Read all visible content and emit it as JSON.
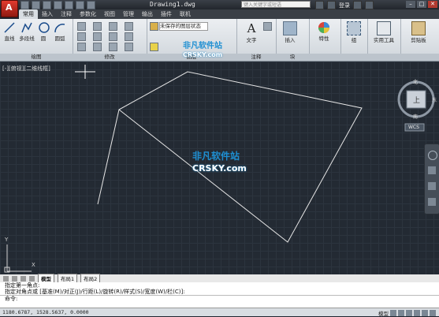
{
  "titlebar": {
    "document_title": "Drawing1.dwg",
    "search_placeholder": "键入关键字或短语",
    "user": "登录",
    "win_minimize": "–",
    "win_restore": "□",
    "win_close": "✕"
  },
  "tabs": [
    "常用",
    "插入",
    "注释",
    "参数化",
    "视图",
    "管理",
    "输出",
    "插件",
    "联机"
  ],
  "ribbon": {
    "panels": [
      {
        "label": "绘图",
        "tools": [
          "直线",
          "多段线",
          "圆",
          "圆弧"
        ]
      },
      {
        "label": "修改",
        "tools": []
      },
      {
        "label": "图层",
        "tools": [
          "未保存的图层状态"
        ]
      },
      {
        "label": "注释",
        "tools": [
          "文字"
        ]
      },
      {
        "label": "块",
        "tools": [
          "插入"
        ]
      },
      {
        "label": "",
        "tools": [
          "特性"
        ]
      },
      {
        "label": "",
        "tools": [
          "组"
        ]
      },
      {
        "label": "",
        "tools": [
          "实用工具"
        ]
      },
      {
        "label": "",
        "tools": [
          "剪贴板"
        ]
      }
    ]
  },
  "viewport": {
    "label": "[-][俯视][二维线框]",
    "viewcube_top": "北",
    "viewcube_face": "上",
    "viewcube_right": "东",
    "viewcube_bottom": "南",
    "wcs_label": "WCS",
    "ucs_y": "Y",
    "ucs_x": "X"
  },
  "watermark": {
    "cn": "非凡软件站",
    "en": "CRSKY.com"
  },
  "layout_tabs": [
    "模型",
    "布局1",
    "布局2"
  ],
  "command": {
    "history_1": "指定第一角点:",
    "history_2": "指定对角点或 [基准(M)/对正(J)/行距(L)/旋转(R)/样式(S)/宽度(W)/栏(C)]:",
    "prompt": "命令:"
  },
  "status": {
    "coordinates": "1180.6787, 1528.5637, 0.0000",
    "space": "模型"
  },
  "colors": {
    "canvas": "#232a33",
    "grid": "#2c343e",
    "polyline": "#e6e6e6",
    "app_red": "#c8281d",
    "watermark": "#1e8fd2"
  }
}
